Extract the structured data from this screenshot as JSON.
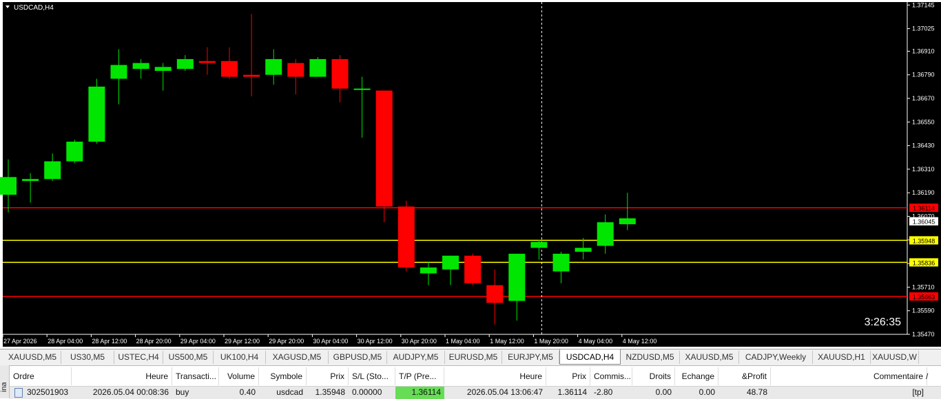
{
  "chart": {
    "title": "USDCAD,H4",
    "countdown": "3:26:35",
    "colors": {
      "background": "#000000",
      "bull": "#00e600",
      "bear": "#ff0000",
      "axis": "#ffffff",
      "tp_line": "#ff0000",
      "entry_line": "#ffff00",
      "sl_line": "#ff0000",
      "current_price": "#ffffff"
    }
  },
  "chart_data": {
    "type": "candlestick",
    "symbol": "USDCAD",
    "timeframe": "H4",
    "ylim": [
      1.3547,
      1.3716
    ],
    "y_ticks": [
      "1.37145",
      "1.37025",
      "1.36910",
      "1.36790",
      "1.36670",
      "1.36550",
      "1.36430",
      "1.36310",
      "1.36190",
      "1.36070",
      "1.35950",
      "1.35830",
      "1.35710",
      "1.35590",
      "1.35470"
    ],
    "x_ticks": [
      "27 Apr 2026",
      "28 Apr 04:00",
      "28 Apr 12:00",
      "28 Apr 20:00",
      "29 Apr 04:00",
      "29 Apr 12:00",
      "29 Apr 20:00",
      "30 Apr 04:00",
      "30 Apr 12:00",
      "30 Apr 20:00",
      "1 May 04:00",
      "1 May 12:00",
      "1 May 20:00",
      "4 May 04:00",
      "4 May 12:00"
    ],
    "candles": [
      {
        "o": 1.3618,
        "h": 1.3636,
        "l": 1.3609,
        "c": 1.3627
      },
      {
        "o": 1.3625,
        "h": 1.3629,
        "l": 1.3614,
        "c": 1.3626
      },
      {
        "o": 1.3626,
        "h": 1.3639,
        "l": 1.3625,
        "c": 1.3635
      },
      {
        "o": 1.3635,
        "h": 1.3646,
        "l": 1.3634,
        "c": 1.3645
      },
      {
        "o": 1.3645,
        "h": 1.3677,
        "l": 1.3644,
        "c": 1.3673
      },
      {
        "o": 1.3677,
        "h": 1.3692,
        "l": 1.3664,
        "c": 1.3684
      },
      {
        "o": 1.3682,
        "h": 1.3687,
        "l": 1.3677,
        "c": 1.3685
      },
      {
        "o": 1.3681,
        "h": 1.3685,
        "l": 1.3671,
        "c": 1.3683
      },
      {
        "o": 1.3682,
        "h": 1.3689,
        "l": 1.3681,
        "c": 1.3687
      },
      {
        "o": 1.3686,
        "h": 1.3693,
        "l": 1.3679,
        "c": 1.3685
      },
      {
        "o": 1.3686,
        "h": 1.3693,
        "l": 1.3677,
        "c": 1.3678
      },
      {
        "o": 1.3679,
        "h": 1.371,
        "l": 1.3668,
        "c": 1.3678
      },
      {
        "o": 1.3679,
        "h": 1.3692,
        "l": 1.3674,
        "c": 1.3687
      },
      {
        "o": 1.3685,
        "h": 1.3687,
        "l": 1.3669,
        "c": 1.3678
      },
      {
        "o": 1.3678,
        "h": 1.3688,
        "l": 1.3678,
        "c": 1.3687
      },
      {
        "o": 1.3687,
        "h": 1.3689,
        "l": 1.3665,
        "c": 1.3672
      },
      {
        "o": 1.3672,
        "h": 1.3678,
        "l": 1.3647,
        "c": 1.3672
      },
      {
        "o": 1.3671,
        "h": 1.3671,
        "l": 1.3604,
        "c": 1.3612
      },
      {
        "o": 1.3612,
        "h": 1.3615,
        "l": 1.3579,
        "c": 1.3581
      },
      {
        "o": 1.3578,
        "h": 1.3584,
        "l": 1.3572,
        "c": 1.3581
      },
      {
        "o": 1.358,
        "h": 1.3587,
        "l": 1.3572,
        "c": 1.3587
      },
      {
        "o": 1.3587,
        "h": 1.3588,
        "l": 1.3572,
        "c": 1.3573
      },
      {
        "o": 1.3572,
        "h": 1.358,
        "l": 1.3552,
        "c": 1.3563
      },
      {
        "o": 1.3564,
        "h": 1.3588,
        "l": 1.3554,
        "c": 1.3588
      },
      {
        "o": 1.3591,
        "h": 1.3595,
        "l": 1.3585,
        "c": 1.3594
      },
      {
        "o": 1.3579,
        "h": 1.3589,
        "l": 1.3573,
        "c": 1.3588
      },
      {
        "o": 1.3589,
        "h": 1.3596,
        "l": 1.3585,
        "c": 1.3591
      },
      {
        "o": 1.3592,
        "h": 1.3608,
        "l": 1.3588,
        "c": 1.3604
      },
      {
        "o": 1.3603,
        "h": 1.3619,
        "l": 1.36,
        "c": 1.3606
      }
    ],
    "levels": [
      {
        "name": "tp",
        "price": 1.36114,
        "label": "1.36114",
        "color": "#ff0000"
      },
      {
        "name": "current",
        "price": 1.36045,
        "label": "1.36045",
        "color": "#ffffff"
      },
      {
        "name": "entry-1",
        "price": 1.35948,
        "label": "1.35948",
        "color": "#ffff00"
      },
      {
        "name": "entry-2",
        "price": 1.35836,
        "label": "1.35836",
        "color": "#ffff00"
      },
      {
        "name": "sl",
        "price": 1.35663,
        "label": "1.35663",
        "color": "#ff0000"
      }
    ],
    "crosshair_candle_index": 24
  },
  "tabs": [
    {
      "label": "XAUUSD,M5",
      "active": false
    },
    {
      "label": "US30,M5",
      "active": false
    },
    {
      "label": "USTEC,H4",
      "active": false
    },
    {
      "label": "US500,M5",
      "active": false
    },
    {
      "label": "UK100,H4",
      "active": false
    },
    {
      "label": "XAGUSD,M5",
      "active": false
    },
    {
      "label": "GBPUSD,M5",
      "active": false
    },
    {
      "label": "AUDJPY,M5",
      "active": false
    },
    {
      "label": "EURUSD,M5",
      "active": false
    },
    {
      "label": "EURJPY,M5",
      "active": false
    },
    {
      "label": "USDCAD,H4",
      "active": true
    },
    {
      "label": "NZDUSD,M5",
      "active": false
    },
    {
      "label": "XAUUSD,M5",
      "active": false
    },
    {
      "label": "CADJPY,Weekly",
      "active": false
    },
    {
      "label": "XAUUSD,H1",
      "active": false
    },
    {
      "label": "XAUUSD,W",
      "active": false
    }
  ],
  "terminal": {
    "side_label": "inal",
    "columns": [
      "Ordre",
      "Heure",
      "Transacti...",
      "Volume",
      "Symbole",
      "Prix",
      "S/L (Sto...",
      "T/P (Pre...",
      "Heure",
      "Prix",
      "Commis...",
      "Droits",
      "Echange",
      "&Profit",
      "Commentaire"
    ],
    "row": [
      "302501903",
      "2026.05.04 00:08:36",
      "buy",
      "0.40",
      "usdcad",
      "1.35948",
      "0.00000",
      "1.36114",
      "2026.05.04 13:06:47",
      "1.36114",
      "-2.80",
      "0.00",
      "0.00",
      "48.78",
      "[tp]"
    ],
    "tp_highlight": "#66dd55",
    "sort_arrow": "/"
  }
}
